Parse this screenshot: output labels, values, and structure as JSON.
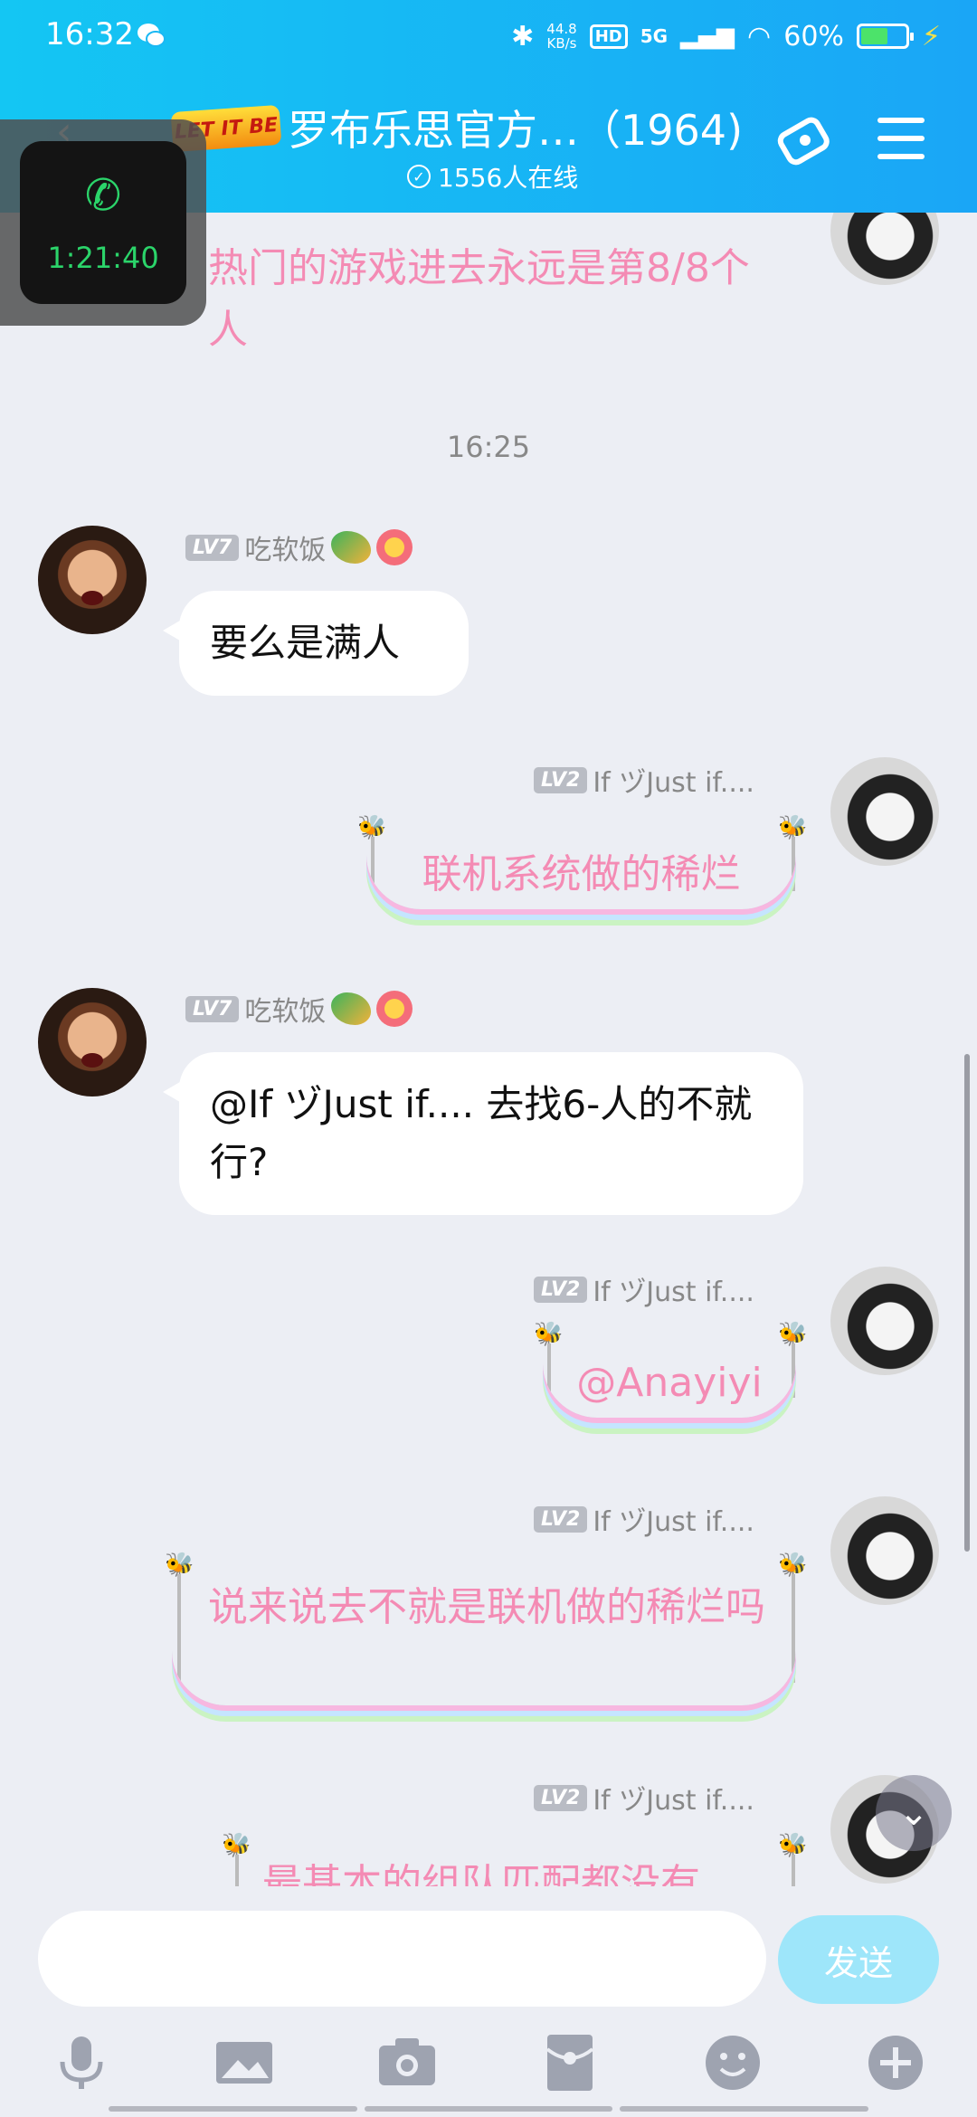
{
  "status_bar": {
    "time": "16:32",
    "net_speed_value": "44.8",
    "net_speed_unit": "KB/s",
    "hd": "HD",
    "signal": "5G",
    "battery": "60%",
    "battery_level": 0.6
  },
  "header": {
    "logo_text": "LET IT BE",
    "title": "罗布乐思官方…（1964)",
    "online": "1556人在线"
  },
  "call": {
    "duration": "1:21:40"
  },
  "messages": {
    "partial_text": "热门的游戏进去永远是第8/8个人",
    "timestamp": "16:25",
    "m1": {
      "level": "LV7",
      "user": "吃软饭",
      "text": "要么是满人"
    },
    "m2": {
      "level": "LV2",
      "user": "If ヅJust if....",
      "text": "联机系统做的稀烂"
    },
    "m3": {
      "level": "LV7",
      "user": "吃软饭",
      "text": "@If ヅJust if.... 去找6-人的不就行?"
    },
    "m4": {
      "level": "LV2",
      "user": "If ヅJust if....",
      "text": "@Anayiyi"
    },
    "m5": {
      "level": "LV2",
      "user": "If ヅJust if....",
      "text": "说来说去不就是联机做的稀烂吗"
    },
    "m6": {
      "level": "LV2",
      "user": "If ヅJust if....",
      "text": "最基本的组队匹配都没有"
    }
  },
  "input": {
    "placeholder": "",
    "send_label": "发送"
  },
  "toolbar_icons": [
    "mic-icon",
    "image-icon",
    "camera-icon",
    "red-packet-icon",
    "emoji-icon",
    "plus-icon"
  ]
}
